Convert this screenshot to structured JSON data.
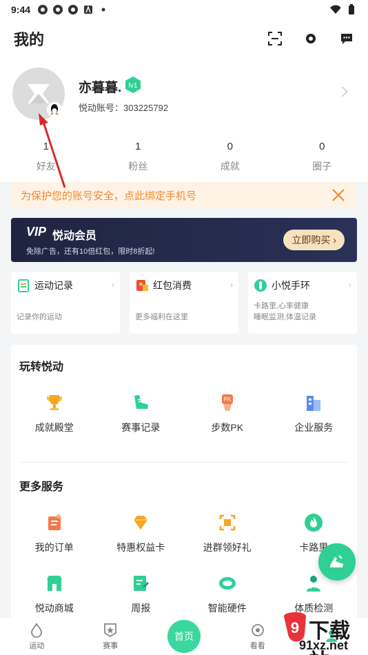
{
  "status_bar": {
    "time": "9:44"
  },
  "header": {
    "title": "我的"
  },
  "profile": {
    "name": "亦暮暮.",
    "level": "lv1",
    "account": "悦动账号：303225792",
    "stats": [
      {
        "num": "1",
        "label": "好友"
      },
      {
        "num": "1",
        "label": "粉丝"
      },
      {
        "num": "0",
        "label": "成就"
      },
      {
        "num": "0",
        "label": "圈子"
      }
    ]
  },
  "bind_banner": {
    "text": "为保护您的账号安全，",
    "link": "点此绑定手机号"
  },
  "vip": {
    "logo": "VIP",
    "title": "悦动会员",
    "subtitle": "免除广告，还有10倍红包，限时8折起!",
    "button": "立即购买 ›"
  },
  "cards": [
    {
      "title": "运动记录",
      "sub": "记录你的运动",
      "icon": "sport-record-icon"
    },
    {
      "title": "红包消费",
      "sub": "更多福利在这里",
      "icon": "red-packet-icon"
    },
    {
      "title": "小悦手环",
      "sub": "卡路里,心率健康\n睡眠监测,体温记录",
      "icon": "band-icon"
    }
  ],
  "play": {
    "title": "玩转悦动",
    "items": [
      {
        "label": "成就殿堂",
        "icon": "trophy-icon"
      },
      {
        "label": "赛事记录",
        "icon": "shoe-icon"
      },
      {
        "label": "步数PK",
        "icon": "pk-icon"
      },
      {
        "label": "企业服务",
        "icon": "building-icon"
      }
    ]
  },
  "more": {
    "title": "更多服务",
    "row1": [
      {
        "label": "我的订单",
        "icon": "order-icon"
      },
      {
        "label": "特惠权益卡",
        "icon": "diamond-icon"
      },
      {
        "label": "进群领好礼",
        "icon": "group-gift-icon"
      },
      {
        "label": "卡路里",
        "icon": "flame-icon"
      }
    ],
    "row2": [
      {
        "label": "悦动商城",
        "icon": "shop-icon"
      },
      {
        "label": "周报",
        "icon": "report-icon"
      },
      {
        "label": "智能硬件",
        "icon": "hardware-icon"
      },
      {
        "label": "体质检测",
        "icon": "doctor-icon"
      }
    ]
  },
  "tabbar": {
    "tabs": [
      {
        "label": "运动"
      },
      {
        "label": "赛事"
      },
      {
        "label": "首页"
      },
      {
        "label": "看看"
      },
      {
        "label": ""
      }
    ]
  },
  "watermark": {
    "line1": "下载站",
    "line2": "91xz.net"
  },
  "colors": {
    "accent": "#2fcf96",
    "orange": "#f08a2c",
    "vip_bg": "#1f2440"
  }
}
